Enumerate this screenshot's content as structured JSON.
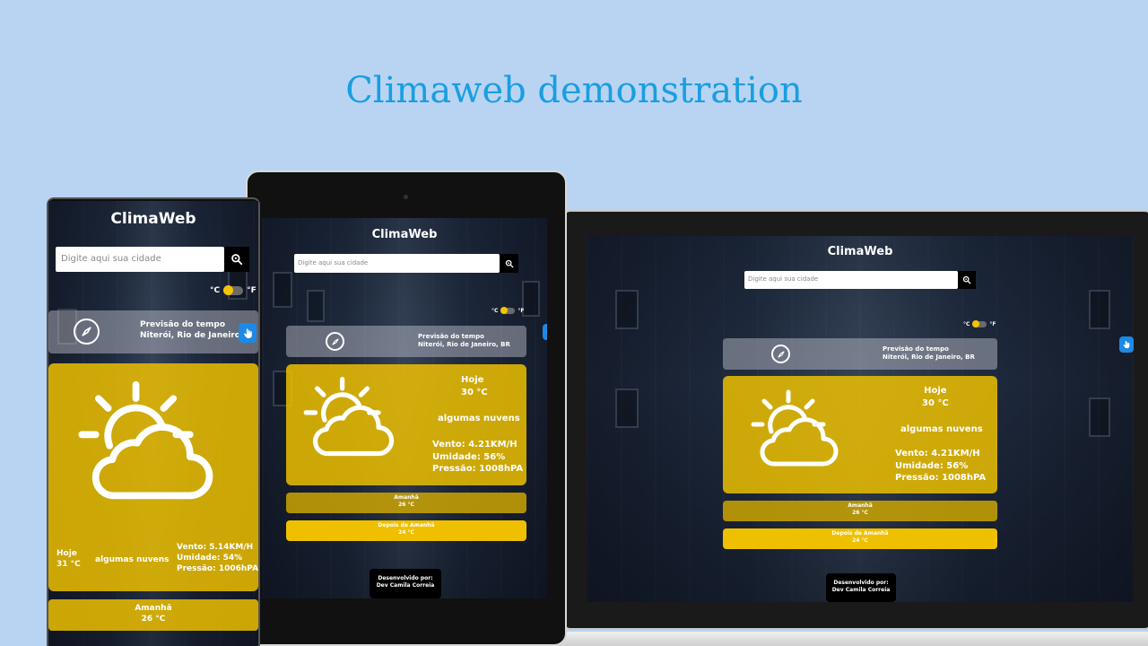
{
  "heading": "Climaweb demonstration",
  "app": {
    "brand": "ClimaWeb",
    "search_placeholder": "Digite aqui sua cidade",
    "unit_c": "°C",
    "unit_f": "°F",
    "forecast_title": "Previsão do tempo",
    "location": "Niterói, Rio de Janeiro, BR",
    "footer_line1": "Desenvolvido por:",
    "footer_line2": "Dev Camila Correia"
  },
  "phone": {
    "location_truncated": "Niterói, Rio de Janeiro, Br",
    "today_label": "Hoje",
    "today_temp": "31 °C",
    "description": "algumas nuvens",
    "wind": "Vento: 5.14KM/H",
    "humidity": "Umidade: 54%",
    "pressure": "Pressão: 1006hPA",
    "tomorrow_label": "Amanhã",
    "tomorrow_temp": "26 °C"
  },
  "tablet": {
    "today_label": "Hoje",
    "today_temp": "30 °C",
    "description": "algumas nuvens",
    "wind": "Vento: 4.21KM/H",
    "humidity": "Umidade: 56%",
    "pressure": "Pressão: 1008hPA",
    "tomorrow_label": "Amanhã",
    "tomorrow_temp": "26 °C",
    "after_label": "Depois de Amanhã",
    "after_temp": "24 °C"
  },
  "laptop": {
    "today_label": "Hoje",
    "today_temp": "30 °C",
    "description": "algumas nuvens",
    "wind": "Vento: 4.21KM/H",
    "humidity": "Umidade: 56%",
    "pressure": "Pressão: 1008hPA",
    "tomorrow_label": "Amanhã",
    "tomorrow_temp": "26 °C",
    "after_label": "Depois de Amanhã",
    "after_temp": "24 °C"
  },
  "icons": {
    "weather": "sun-behind-cloud-icon",
    "search": "search-location-icon",
    "compass": "compass-icon",
    "geolocate": "hand-pointer-icon"
  },
  "colors": {
    "background": "#b8d4f2",
    "heading": "#1a9ee0",
    "card": "#ecc000",
    "toggle_knob": "#f5c400",
    "geo_button": "#1e88e5"
  }
}
